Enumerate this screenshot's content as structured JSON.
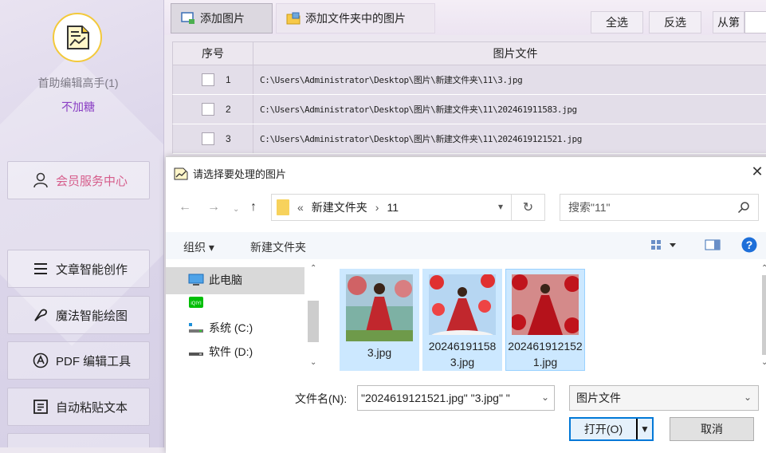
{
  "sidebar": {
    "app_name": "首助编辑高手(1)",
    "status": "不加糖",
    "member_center": "会员服务中心",
    "items": [
      {
        "label": "文章智能创作",
        "icon": "list-icon"
      },
      {
        "label": "魔法智能绘图",
        "icon": "magic-wand-icon"
      },
      {
        "label": "PDF 编辑工具",
        "icon": "pdf-icon"
      },
      {
        "label": "自动粘贴文本",
        "icon": "paste-icon"
      }
    ]
  },
  "toolbar": {
    "add_image": "添加图片",
    "add_folder_images": "添加文件夹中的图片",
    "select_all": "全选",
    "invert_select": "反选",
    "from_label": "从第"
  },
  "table": {
    "columns": [
      "序号",
      "图片文件"
    ],
    "rows": [
      {
        "index": "1",
        "path": "C:\\Users\\Administrator\\Desktop\\图片\\新建文件夹\\11\\3.jpg"
      },
      {
        "index": "2",
        "path": "C:\\Users\\Administrator\\Desktop\\图片\\新建文件夹\\11\\202461911583.jpg"
      },
      {
        "index": "3",
        "path": "C:\\Users\\Administrator\\Desktop\\图片\\新建文件夹\\11\\2024619121521.jpg"
      }
    ]
  },
  "dialog": {
    "title": "请选择要处理的图片",
    "address": {
      "prefix": "«",
      "folder": "新建文件夹",
      "separator": "›",
      "subfolder": "11"
    },
    "search_placeholder": "搜索\"11\"",
    "organize": "组织 ▾",
    "new_folder": "新建文件夹",
    "tree": [
      {
        "label": "此电脑",
        "icon": "computer-icon"
      },
      {
        "label": "",
        "icon": "iqiyi-icon"
      },
      {
        "label": "系统 (C:)",
        "icon": "drive-c-icon"
      },
      {
        "label": "软件 (D:)",
        "icon": "drive-d-icon"
      }
    ],
    "files": [
      {
        "name": "3.jpg"
      },
      {
        "name": "202461911583.jpg"
      },
      {
        "name": "2024619121521.jpg"
      }
    ],
    "filename_label": "文件名(N):",
    "filename_value": "\"2024619121521.jpg\" \"3.jpg\" \"",
    "file_type": "图片文件",
    "open": "打开(O)",
    "cancel": "取消"
  }
}
